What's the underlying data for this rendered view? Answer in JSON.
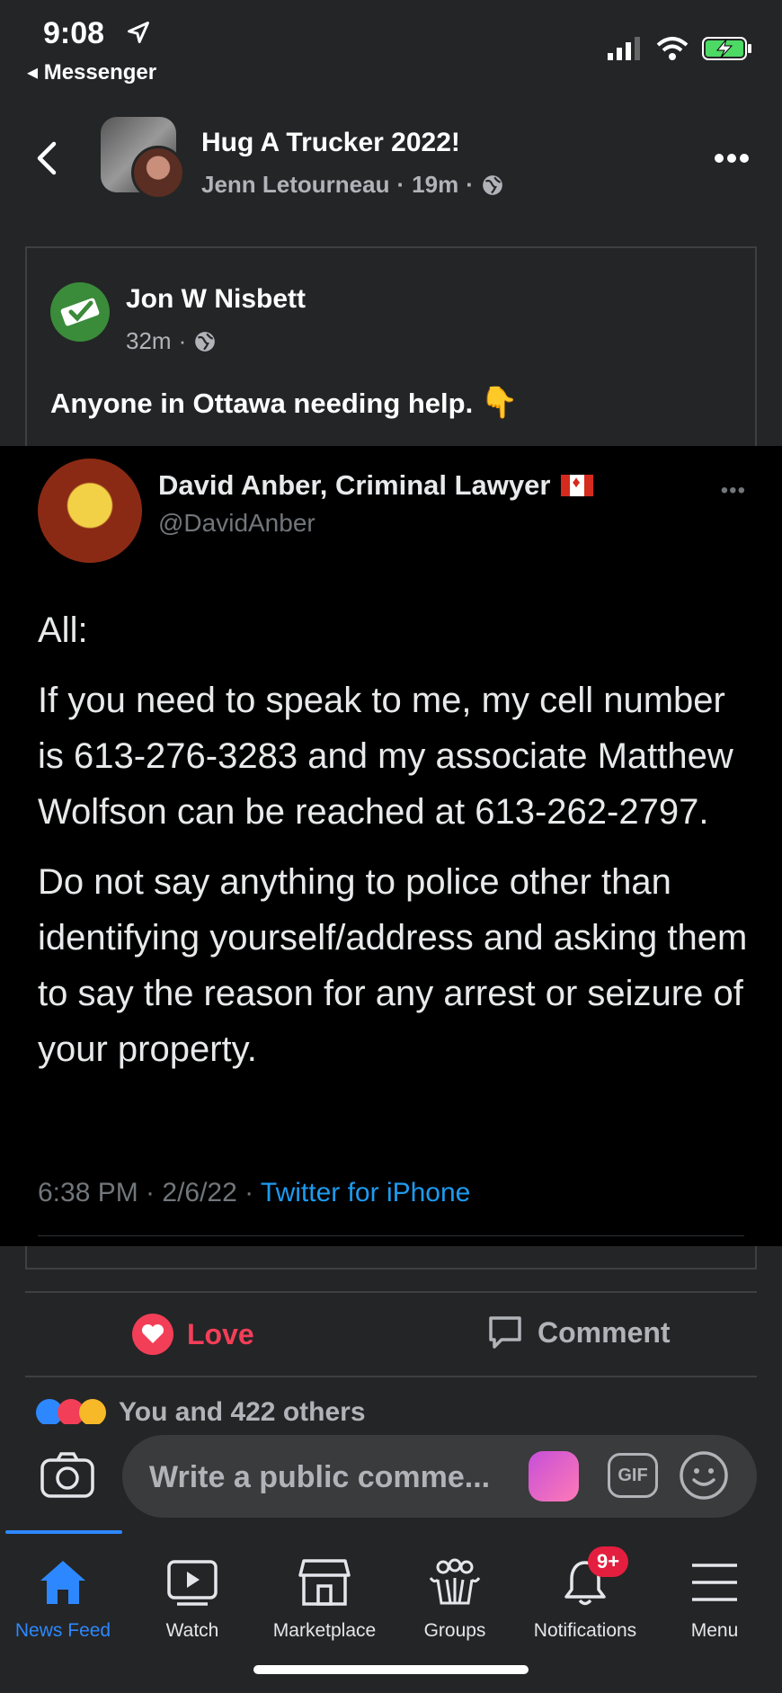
{
  "status_bar": {
    "time": "9:08",
    "back_app": "Messenger"
  },
  "header": {
    "group_name": "Hug A Trucker 2022!",
    "author": "Jenn Letourneau",
    "time": "19m",
    "separator": "·"
  },
  "shared_post": {
    "author": "Jon W Nisbett",
    "time": "32m",
    "text": "Anyone in Ottawa needing help."
  },
  "tweet": {
    "name": "David Anber, Criminal Lawyer",
    "handle": "@DavidAnber",
    "paragraphs": [
      "All:",
      "If you need to speak to me, my cell number is 613-276-3283 and my associate Matthew Wolfson can be reached at 613-262-2797.",
      "Do not say anything to police other than identifying yourself/address and asking them to say the reason for any arrest or seizure of your property."
    ],
    "timestamp": "6:38 PM · 2/6/22 · ",
    "source": "Twitter for iPhone"
  },
  "actions": {
    "love": "Love",
    "comment": "Comment"
  },
  "reactions": {
    "text": "You and 422 others"
  },
  "composer": {
    "placeholder": "Write a public comme...",
    "gif": "GIF"
  },
  "tabs": [
    {
      "label": "News Feed"
    },
    {
      "label": "Watch"
    },
    {
      "label": "Marketplace"
    },
    {
      "label": "Groups"
    },
    {
      "label": "Notifications",
      "badge": "9+"
    },
    {
      "label": "Menu"
    }
  ],
  "colors": {
    "accent": "#2d88ff",
    "love": "#f33e58",
    "badge": "#e41e3f",
    "twitter_link": "#1d9bf0"
  }
}
